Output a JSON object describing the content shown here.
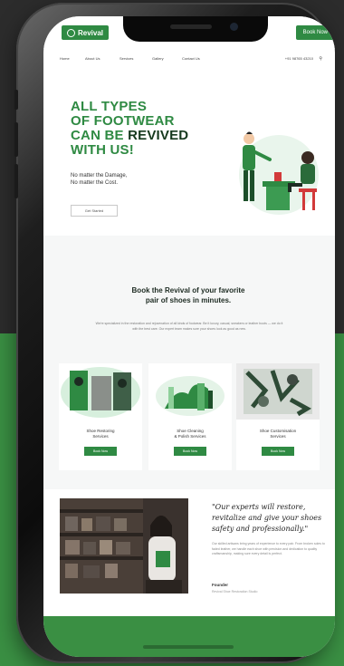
{
  "colors": {
    "brand_green": "#2f8a43",
    "dark_green": "#16391e",
    "background": "#2c2c2c",
    "accent_green_bg": "#3a8f43"
  },
  "topbar": {
    "logo_text": "Revival",
    "cta_label": "Book Now"
  },
  "nav": {
    "items": [
      "Home",
      "About Us",
      "Services",
      "Gallery",
      "Contact Us"
    ],
    "right_text": "+91 98765 43210",
    "search_icon": "search-icon"
  },
  "hero": {
    "title_line1": "ALL TYPES",
    "title_line2": "OF FOOTWEAR",
    "title_line3_prefix": "CAN BE ",
    "title_line3_strong": "REVIVED",
    "title_line4": "WITH US!",
    "sub_line1": "No matter the Damage,",
    "sub_line2": "No matter the Cost.",
    "button_label": "Get Started"
  },
  "band": {
    "title_line1": "Book the Revival of your favorite",
    "title_line2": "pair of shoes in minutes.",
    "description": "We're specialized in the restoration and rejuvenation of all kinds of footwear. Be it luxury, casual, sneakers or leather boots — we do it with the best care. Our expert team makes sure your shoes look as good as new."
  },
  "cards": [
    {
      "label_line1": "Shoe Restoring",
      "label_line2": "Services",
      "button": "Book Now"
    },
    {
      "label_line1": "Shoe Cleaning",
      "label_line2": "& Polish Services",
      "button": "Book Now"
    },
    {
      "label_line1": "Shoe Customisation",
      "label_line2": "Services",
      "button": "Book Now"
    }
  ],
  "testimonial": {
    "quote": "\"Our experts will restore, revitalize and give your shoes safety and professionally.\"",
    "description": "Our skilled artisans bring years of experience to every pair. From broken soles to faded leather, we handle each shoe with precision and dedication to quality craftsmanship, making sure every detail is perfect.",
    "name": "Founder",
    "role": "Revival Shoe Restoration Studio"
  }
}
